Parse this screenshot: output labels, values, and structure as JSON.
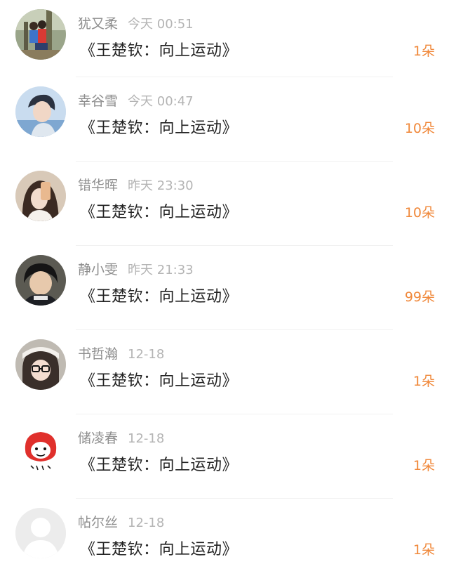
{
  "accent_color": "#f0883a",
  "items": [
    {
      "name": "犹又柔",
      "time": "今天 00:51",
      "title": "《王楚钦：向上运动》",
      "count": "1朵",
      "avatar_icon": "photo-avatar-icon"
    },
    {
      "name": "幸谷雪",
      "time": "今天 00:47",
      "title": "《王楚钦：向上运动》",
      "count": "10朵",
      "avatar_icon": "photo-avatar-icon"
    },
    {
      "name": "错华晖",
      "time": "昨天 23:30",
      "title": "《王楚钦：向上运动》",
      "count": "10朵",
      "avatar_icon": "photo-avatar-icon"
    },
    {
      "name": "静小雯",
      "time": "昨天 21:33",
      "title": "《王楚钦：向上运动》",
      "count": "99朵",
      "avatar_icon": "photo-avatar-icon"
    },
    {
      "name": "书哲瀚",
      "time": "12-18",
      "title": "《王楚钦：向上运动》",
      "count": "1朵",
      "avatar_icon": "photo-avatar-icon"
    },
    {
      "name": "储凌春",
      "time": "12-18",
      "title": "《王楚钦：向上运动》",
      "count": "1朵",
      "avatar_icon": "cartoon-avatar-icon"
    },
    {
      "name": "帖尔丝",
      "time": "12-18",
      "title": "《王楚钦：向上运动》",
      "count": "1朵",
      "avatar_icon": "default-avatar-icon"
    }
  ]
}
